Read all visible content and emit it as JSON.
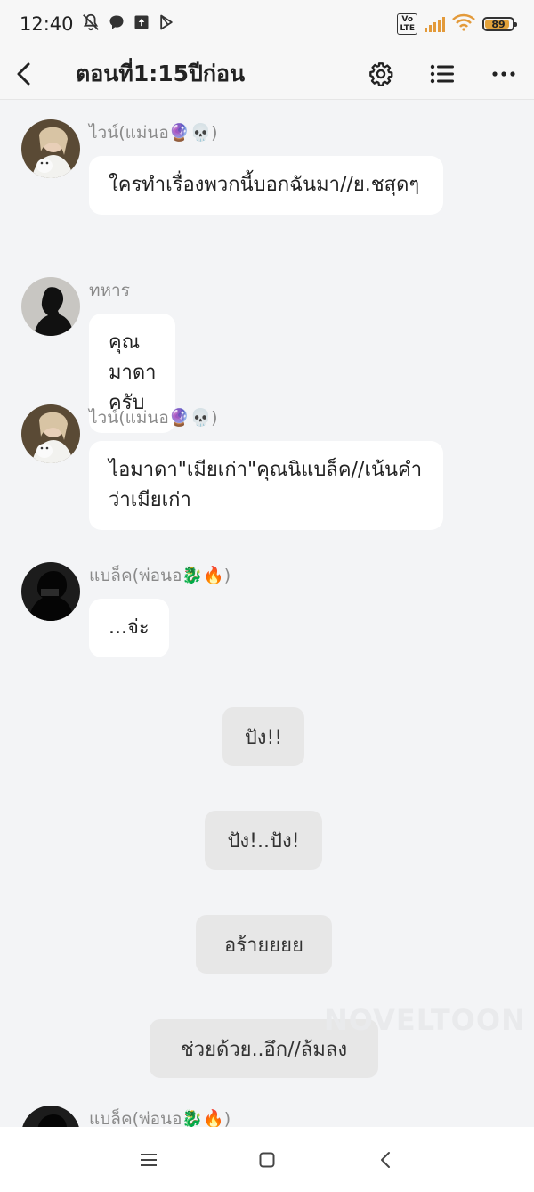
{
  "status": {
    "time": "12:40",
    "volte": "Vo\nLTE",
    "battery": "89"
  },
  "header": {
    "title": "ตอนที่1:15ปีก่อน"
  },
  "messages": [
    {
      "name": "ไวน์(แม่นอ🔮💀)",
      "text": "ใครทำเรื่องพวกนี้บอกฉันมา//ย.ชสุดๆ"
    },
    {
      "name": "ทหาร",
      "text": "คุณมาดาครับ"
    },
    {
      "name": "ไวน์(แม่นอ🔮💀)",
      "text": "ไอมาดา\"เมียเก่า\"คุณนิแบล็ค//เน้นคำว่าเมียเก่า"
    },
    {
      "name": "แบล็ค(พ่อนอ🐉🔥)",
      "text": "...จ่ะ"
    },
    {
      "name": "แบล็ค(พ่อนอ🐉🔥)"
    }
  ],
  "narration": [
    "ปัง!!",
    "ปัง!..ปัง!",
    "อร้ายยยย",
    "ช่วยด้วย..อึก//ล้มลง"
  ],
  "watermark": "NOVELTOON",
  "colors": {
    "background": "#f3f4f6",
    "bubble": "#ffffff",
    "narration": "#e7e7e7",
    "accent": "#e39a3a"
  }
}
